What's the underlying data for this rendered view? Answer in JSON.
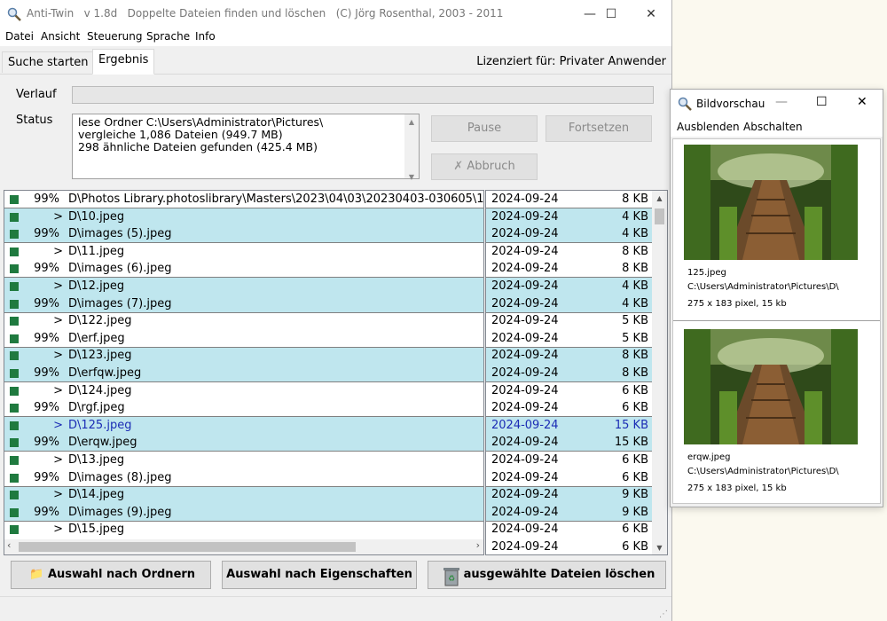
{
  "window": {
    "title": "Anti-Twin   v 1.8d   Doppelte Dateien finden und löschen   (C) Jörg Rosenthal, 2003 - 2011",
    "controls": {
      "minimize": "—",
      "maximize": "☐",
      "close": "✕"
    }
  },
  "menu": [
    "Datei",
    "Ansicht",
    "Steuerung",
    "Sprache",
    "Info"
  ],
  "tabs": [
    "Suche starten",
    "Ergebnis"
  ],
  "license": "Lizenziert für: Privater Anwender",
  "labels": {
    "verlauf": "Verlauf",
    "status": "Status"
  },
  "progress": {
    "value": 0
  },
  "status_lines": [
    "lese Ordner C:\\Users\\Administrator\\Pictures\\",
    "vergleiche 1,086 Dateien (949.7 MB)",
    "298 ähnliche Dateien gefunden (425.4 MB)"
  ],
  "buttons": {
    "pause": "Pause",
    "fortsetzen": "Fortsetzen",
    "abbruch": "Abbruch"
  },
  "rows": [
    {
      "mark": "99%",
      "path": "D\\Photos Library.photoslibrary\\Masters\\2023\\04\\03\\20230403-030605\\1",
      "date": "2024-09-24",
      "size": "8 KB",
      "hl": false,
      "sep": true,
      "sel": false
    },
    {
      "mark": ">",
      "path": "D\\10.jpeg",
      "date": "2024-09-24",
      "size": "4 KB",
      "hl": true,
      "sep": false,
      "sel": false
    },
    {
      "mark": "99%",
      "path": "D\\images (5).jpeg",
      "date": "2024-09-24",
      "size": "4 KB",
      "hl": true,
      "sep": true,
      "sel": false
    },
    {
      "mark": ">",
      "path": "D\\11.jpeg",
      "date": "2024-09-24",
      "size": "8 KB",
      "hl": false,
      "sep": false,
      "sel": false
    },
    {
      "mark": "99%",
      "path": "D\\images (6).jpeg",
      "date": "2024-09-24",
      "size": "8 KB",
      "hl": false,
      "sep": true,
      "sel": false
    },
    {
      "mark": ">",
      "path": "D\\12.jpeg",
      "date": "2024-09-24",
      "size": "4 KB",
      "hl": true,
      "sep": false,
      "sel": false
    },
    {
      "mark": "99%",
      "path": "D\\images (7).jpeg",
      "date": "2024-09-24",
      "size": "4 KB",
      "hl": true,
      "sep": true,
      "sel": false
    },
    {
      "mark": ">",
      "path": "D\\122.jpeg",
      "date": "2024-09-24",
      "size": "5 KB",
      "hl": false,
      "sep": false,
      "sel": false
    },
    {
      "mark": "99%",
      "path": "D\\erf.jpeg",
      "date": "2024-09-24",
      "size": "5 KB",
      "hl": false,
      "sep": true,
      "sel": false
    },
    {
      "mark": ">",
      "path": "D\\123.jpeg",
      "date": "2024-09-24",
      "size": "8 KB",
      "hl": true,
      "sep": false,
      "sel": false
    },
    {
      "mark": "99%",
      "path": "D\\erfqw.jpeg",
      "date": "2024-09-24",
      "size": "8 KB",
      "hl": true,
      "sep": true,
      "sel": false
    },
    {
      "mark": ">",
      "path": "D\\124.jpeg",
      "date": "2024-09-24",
      "size": "6 KB",
      "hl": false,
      "sep": false,
      "sel": false
    },
    {
      "mark": "99%",
      "path": "D\\rgf.jpeg",
      "date": "2024-09-24",
      "size": "6 KB",
      "hl": false,
      "sep": true,
      "sel": false
    },
    {
      "mark": ">",
      "path": "D\\125.jpeg",
      "date": "2024-09-24",
      "size": "15 KB",
      "hl": true,
      "sep": false,
      "sel": true
    },
    {
      "mark": "99%",
      "path": "D\\erqw.jpeg",
      "date": "2024-09-24",
      "size": "15 KB",
      "hl": true,
      "sep": true,
      "sel": false
    },
    {
      "mark": ">",
      "path": "D\\13.jpeg",
      "date": "2024-09-24",
      "size": "6 KB",
      "hl": false,
      "sep": false,
      "sel": false
    },
    {
      "mark": "99%",
      "path": "D\\images (8).jpeg",
      "date": "2024-09-24",
      "size": "6 KB",
      "hl": false,
      "sep": true,
      "sel": false
    },
    {
      "mark": ">",
      "path": "D\\14.jpeg",
      "date": "2024-09-24",
      "size": "9 KB",
      "hl": true,
      "sep": false,
      "sel": false
    },
    {
      "mark": "99%",
      "path": "D\\images (9).jpeg",
      "date": "2024-09-24",
      "size": "9 KB",
      "hl": true,
      "sep": true,
      "sel": false
    },
    {
      "mark": ">",
      "path": "D\\15.jpeg",
      "date": "2024-09-24",
      "size": "6 KB",
      "hl": false,
      "sep": false,
      "sel": false
    },
    {
      "mark": "",
      "path": "",
      "date": "2024-09-24",
      "size": "6 KB",
      "hl": false,
      "sep": false,
      "sel": false
    }
  ],
  "bottom_buttons": {
    "folders": "Auswahl nach Ordnern",
    "properties": "Auswahl nach Eigenschaften",
    "delete": "ausgewählte Dateien löschen"
  },
  "preview": {
    "title": "Bildvorschau",
    "menu": [
      "Ausblenden",
      "Abschalten"
    ],
    "items": [
      {
        "name": "125.jpeg",
        "folder": "C:\\Users\\Administrator\\Pictures\\D\\",
        "info": "275 x 183 pixel, 15 kb"
      },
      {
        "name": "erqw.jpeg",
        "folder": "C:\\Users\\Administrator\\Pictures\\D\\",
        "info": "275 x 183 pixel, 15 kb"
      }
    ]
  },
  "colors": {
    "row_highlight": "#bfe6ee",
    "marker": "#1f7a3f",
    "selected_text": "#1c2db5"
  }
}
